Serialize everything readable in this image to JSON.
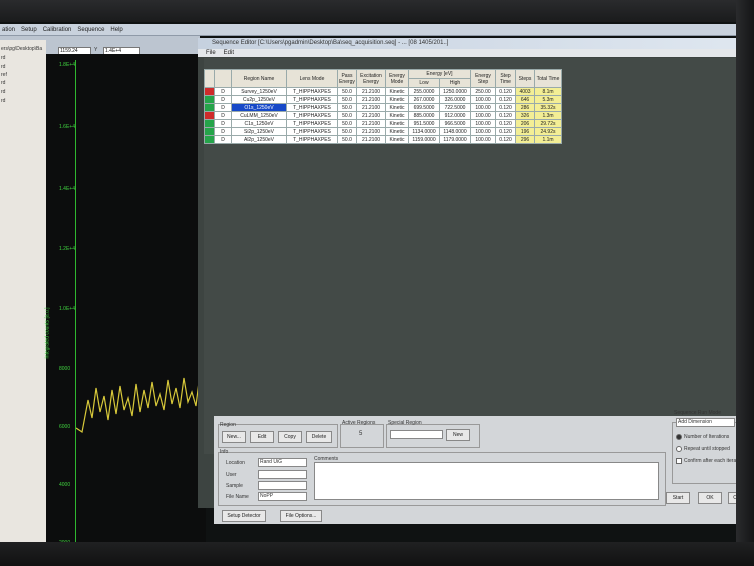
{
  "app_menu": [
    "ation",
    "Setup",
    "Calibration",
    "Sequence",
    "Help"
  ],
  "app_toolbar": {
    "field1": "1159.24",
    "field2_label": "Y",
    "field2": "1.4E+4"
  },
  "tree_items": [
    "ers\\pg\\Desktop\\Ba",
    "rd",
    "rd",
    "ref",
    "rd",
    "rd",
    "rd"
  ],
  "plot": {
    "y_ticks": [
      "1.8E+4",
      "1.6E+4",
      "1.4E+4",
      "1.2E+4",
      "1.0E+4",
      "8000",
      "6000",
      "4000",
      "2000"
    ],
    "ylabel": "Integrated counts [a.u.]",
    "line_color": "#d8c93a",
    "axis_color": "#2fb62f"
  },
  "seq_window": {
    "title": "Sequence Editor [C:\\Users\\pgadmin\\Desktop\\Ba\\seq_acquisition.seq] - ... [08 1405/201..]",
    "menu": [
      "File",
      "Edit"
    ]
  },
  "table": {
    "headers": {
      "region_name": "Region Name",
      "lens_mode": "Lens Mode",
      "pass_energy": "Pass Energy",
      "excitation": "Excitation Energy",
      "energy_mode": "Energy Mode",
      "energy_ev": "Energy [eV]",
      "low": "Low",
      "high": "High",
      "step": "Energy Step",
      "step_time": "Step Time",
      "steps": "Steps",
      "total": "Total Time"
    },
    "rows": [
      {
        "status": "red",
        "d": "D",
        "name": "Survey_1250eV",
        "lens": "T_HIPPHAXPES",
        "pass": "50.0",
        "exc": "21.2100",
        "mode": "Kinetic",
        "low": "255.0000",
        "high": "1250.0000",
        "estep": "250.00",
        "stime": "0.120",
        "steps": "4003",
        "total": "8.1m"
      },
      {
        "status": "green",
        "d": "D",
        "name": "Cu2p_1250eV",
        "lens": "T_HIPPHAXPES",
        "pass": "50.0",
        "exc": "21.2100",
        "mode": "Kinetic",
        "low": "267.0000",
        "high": "326.0000",
        "estep": "100.00",
        "stime": "0.120",
        "steps": "646",
        "total": "5.3m"
      },
      {
        "status": "green",
        "d": "D",
        "name": "O1s_1250eV",
        "lens": "T_HIPPHAXPES",
        "pass": "50.0",
        "exc": "21.2100",
        "mode": "Kinetic",
        "low": "699.5000",
        "high": "722.5000",
        "estep": "100.00",
        "stime": "0.120",
        "steps": "286",
        "total": "35.32s",
        "selected": true
      },
      {
        "status": "red",
        "d": "D",
        "name": "CuLMM_1250eV",
        "lens": "T_HIPPHAXPES",
        "pass": "50.0",
        "exc": "21.2100",
        "mode": "Kinetic",
        "low": "885.0000",
        "high": "912.0000",
        "estep": "100.00",
        "stime": "0.120",
        "steps": "326",
        "total": "1.3m"
      },
      {
        "status": "green",
        "d": "D",
        "name": "C1s_1250eV",
        "lens": "T_HIPPHAXPES",
        "pass": "50.0",
        "exc": "21.2100",
        "mode": "Kinetic",
        "low": "951.5000",
        "high": "966.5000",
        "estep": "100.00",
        "stime": "0.120",
        "steps": "206",
        "total": "29.72s"
      },
      {
        "status": "green",
        "d": "D",
        "name": "Si2p_1250eV",
        "lens": "T_HIPPHAXPES",
        "pass": "50.0",
        "exc": "21.2100",
        "mode": "Kinetic",
        "low": "1134.0000",
        "high": "1148.0000",
        "estep": "100.00",
        "stime": "0.120",
        "steps": "196",
        "total": "24.92s"
      },
      {
        "status": "green",
        "d": "D",
        "name": "Al2p_1250eV",
        "lens": "T_HIPPHAXPES",
        "pass": "50.0",
        "exc": "21.2100",
        "mode": "Kinetic",
        "low": "1159.0000",
        "high": "1179.0000",
        "estep": "100.00",
        "stime": "0.120",
        "steps": "296",
        "total": "1.1m"
      }
    ]
  },
  "ctrl": {
    "region_label": "Region",
    "new": "New...",
    "edit": "Edit",
    "copy": "Copy",
    "delete": "Delete",
    "active_label": "Active Regions",
    "active_value": "5",
    "special_label": "Special Region",
    "special_new": "New",
    "info_label": "Info",
    "location_label": "Location",
    "location_value": "Rand UiG",
    "user_label": "User",
    "sample_label": "Sample",
    "file_label": "File Name",
    "file_value": "NoPP",
    "comments_label": "Comments",
    "setup_detector": "Setup Detector",
    "file_options": "File Options...",
    "run_mode_label": "Sequence Run Mode",
    "run_mode_value": "Add Dimension",
    "opt_iterations": "Number of Iterations",
    "opt_repeat": "Repeat until stopped",
    "opt_confirm": "Confirm after each iteration",
    "start": "Start",
    "ok": "OK",
    "cancel": "Cancel"
  }
}
